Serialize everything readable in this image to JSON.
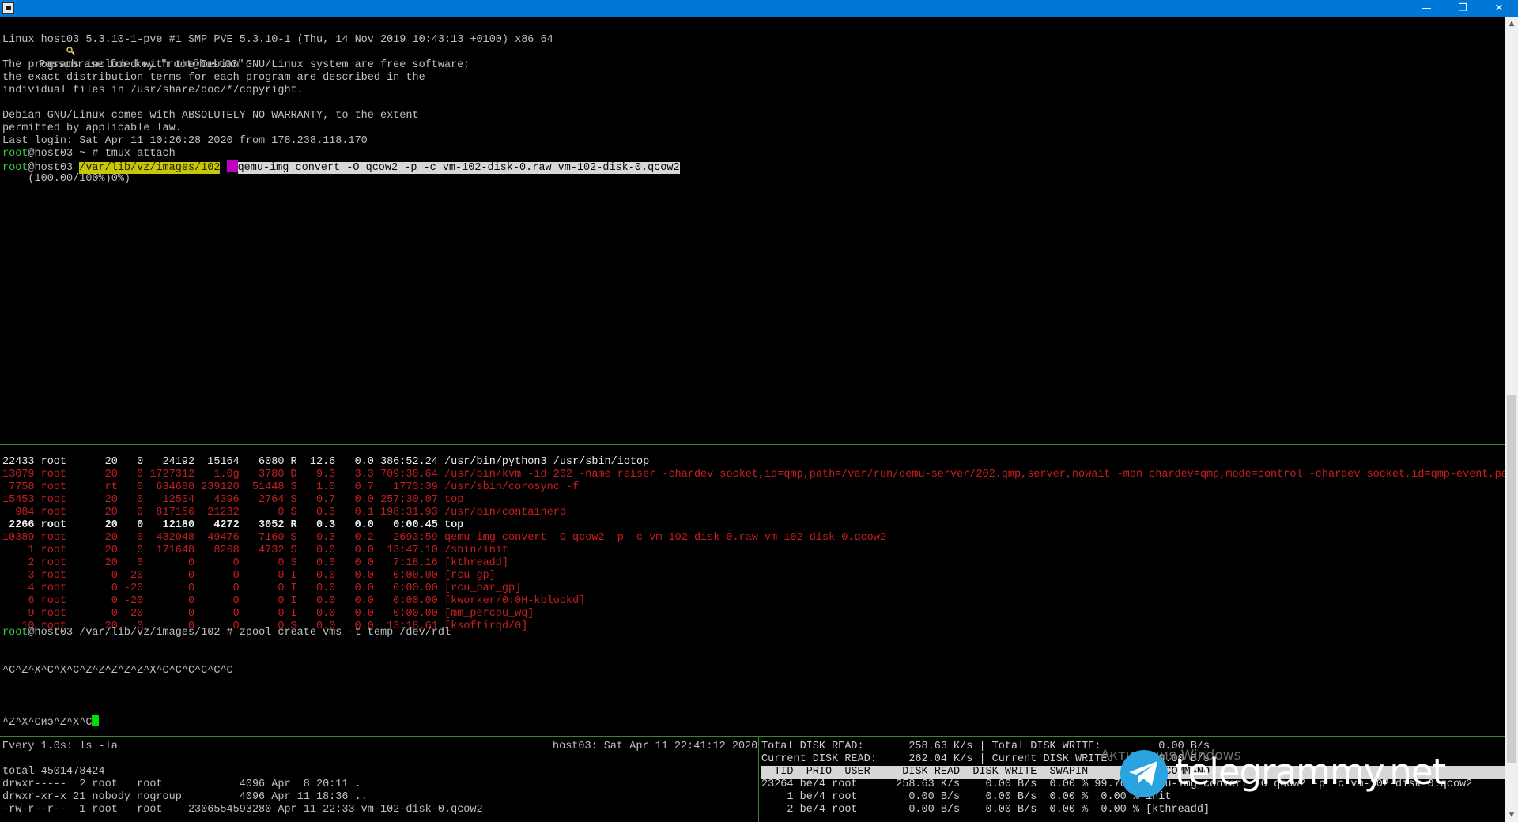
{
  "window": {
    "title_icon": "putty-icon",
    "minimize": "—",
    "restore": "❐",
    "close": "✕"
  },
  "top_pane": {
    "key_icon": "key-icon",
    "lines": [
      "Passphrase for key \"root@host03\":",
      "Linux host03 5.3.10-1-pve #1 SMP PVE 5.3.10-1 (Thu, 14 Nov 2019 10:43:13 +0100) x86_64",
      "",
      "The programs included with the Debian GNU/Linux system are free software;",
      "the exact distribution terms for each program are described in the",
      "individual files in /usr/share/doc/*/copyright.",
      "",
      "Debian GNU/Linux comes with ABSOLUTELY NO WARRANTY, to the extent",
      "permitted by applicable law.",
      "Last login: Sat Apr 11 10:26:28 2020 from 178.238.118.170"
    ],
    "tmux_prompt": {
      "user": "root",
      "host": "@host03",
      "rest": " ~ # tmux attach"
    },
    "convert_prompt": {
      "user": "root",
      "host": "@host03",
      "path": "/var/lib/vz/images/102",
      "command": "qemu-img convert -O qcow2 -p -c vm-102-disk-0.raw vm-102-disk-0.qcow2"
    },
    "progress": "    (100.00/100%)0%)"
  },
  "top_processes": [
    {
      "line": "22433 root      20   0   24192  15164   6080 R  12.6   0.0 386:52.24 /usr/bin/python3 /usr/sbin/iotop",
      "style": "white"
    },
    {
      "line": "13079 root      20   0 1727312   1.0g   3780 D   9.3   3.3 709:30.64 /usr/bin/kvm -id 202 -name reiser -chardev socket,id=qmp,path=/var/run/qemu-server/202.qmp,server,nowait -mon chardev=qmp,mode=control -chardev socket,id=qmp-event,pa+",
      "style": "red"
    },
    {
      "line": " 7758 root      rt   0  634688 239120  51448 S   1.0   0.7   1773:39 /usr/sbin/corosync -f",
      "style": "red"
    },
    {
      "line": "15453 root      20   0   12504   4396   2764 S   0.7   0.0 257:30.07 top",
      "style": "red"
    },
    {
      "line": "  984 root      20   0  817156  21232      0 S   0.3   0.1 198:31.93 /usr/bin/containerd",
      "style": "red"
    },
    {
      "line": " 2266 root      20   0   12180   4272   3052 R   0.3   0.0   0:00.45 top",
      "style": "white-bold"
    },
    {
      "line": "10389 root      20   0  432048  49476   7160 S   0.3   0.2   2693:59 qemu-img convert -O qcow2 -p -c vm-102-disk-0.raw vm-102-disk-0.qcow2",
      "style": "red"
    },
    {
      "line": "    1 root      20   0  171648   8268   4732 S   0.0   0.0  13:47.10 /sbin/init",
      "style": "red"
    },
    {
      "line": "    2 root      20   0       0      0      0 S   0.0   0.0   7:18.16 [kthreadd]",
      "style": "red"
    },
    {
      "line": "    3 root       0 -20       0      0      0 I   0.0   0.0   0:00.00 [rcu_gp]",
      "style": "red"
    },
    {
      "line": "    4 root       0 -20       0      0      0 I   0.0   0.0   0:00.00 [rcu_par_gp]",
      "style": "red"
    },
    {
      "line": "    6 root       0 -20       0      0      0 I   0.0   0.0   0:00.00 [kworker/0:0H-kblockd]",
      "style": "red"
    },
    {
      "line": "    9 root       0 -20       0      0      0 I   0.0   0.0   0:00.00 [mm_percpu_wq]",
      "style": "red"
    },
    {
      "line": "   10 root      20   0       0      0      0 S   0.0   0.0  13:18.61 [ksoftirqd/0]",
      "style": "red"
    }
  ],
  "mid_pane": {
    "zpool_prompt": {
      "user": "root",
      "host": "@host03",
      "rest": " /var/lib/vz/images/102 # zpool create vms -t temp /dev/rdl"
    },
    "ctrl_line_1": "^C^Z^X^C^X^C^Z^Z^Z^Z^Z^X^C^C^C^C^C^C",
    "ctrl_line_2": "^Z^X^Cиэ^Z^X^C"
  },
  "watch_pane": {
    "header_left": "Every 1.0s: ls -la",
    "header_right": "host03: Sat Apr 11 22:41:12 2020",
    "lines": [
      "total 4501478424",
      "drwxr-----  2 root   root            4096 Apr  8 20:11 .",
      "drwxr-xr-x 21 nobody nogroup         4096 Apr 11 18:36 ..",
      "-rw-r--r--  1 root   root    2306554593280 Apr 11 22:33 vm-102-disk-0.qcow2"
    ]
  },
  "iotop_pane": {
    "total_line": "Total DISK READ:       258.63 K/s | Total DISK WRITE:         0.00 B/s",
    "current_line": "Current DISK READ:     262.04 K/s | Current DISK WRITE:       0.00 B/s",
    "header": "  TID  PRIO  USER     DISK READ  DISK WRITE  SWAPIN     IO>    COMMAND",
    "rows": [
      "23264 be/4 root      258.63 K/s    0.00 B/s  0.00 % 99.76 % qemu-img convert -O qcow2 -p -c vm-102-disk-0.qcow2",
      "    1 be/4 root        0.00 B/s    0.00 B/s  0.00 %  0.00 % init",
      "    2 be/4 root        0.00 B/s    0.00 B/s  0.00 %  0.00 % [kthreadd]"
    ]
  },
  "activation_watermark": "Активация Windows",
  "telegram_watermark": "telegrammy.net",
  "colors": {
    "titlebar": "#0078d7",
    "prompt_green": "#3cc83c",
    "process_red": "#c81e1e",
    "divider_green": "#2e8b2e",
    "path_highlight": "#c7c707",
    "telegram_blue": "#2aa3e0"
  }
}
